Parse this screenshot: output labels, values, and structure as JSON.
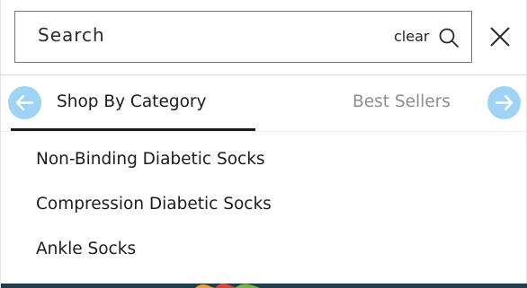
{
  "search": {
    "placeholder": "Search",
    "clear_label": "clear",
    "search_icon": "search-icon",
    "close_icon": "close-icon"
  },
  "tabs": [
    {
      "label": "Shop By Category",
      "active": true
    },
    {
      "label": "Best Sellers",
      "active": false
    }
  ],
  "nav": {
    "prev_icon": "arrow-left-icon",
    "next_icon": "arrow-right-icon"
  },
  "categories": [
    {
      "label": "Non-Binding Diabetic Socks"
    },
    {
      "label": "Compression Diabetic Socks"
    },
    {
      "label": "Ankle Socks"
    }
  ],
  "colors": {
    "arrow_bg": "#9fd3f3",
    "active_tab": "#1c1c1c",
    "inactive_tab": "#8d8d8d",
    "footer_bar": "#1e3d4f"
  }
}
